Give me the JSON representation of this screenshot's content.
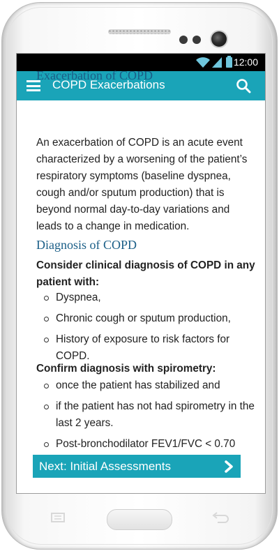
{
  "status_bar": {
    "time": "12:00"
  },
  "app_bar": {
    "title": "COPD Exacerbations"
  },
  "content": {
    "section1_title": "Exacerbation of COPD",
    "section1_text": "An exacerbation of COPD is an acute event characterized by a worsening of the patient’s respiratory symptoms (baseline dyspnea, cough and/or sputum production) that is beyond normal day-to-day variations and leads to a change in medication.",
    "section2_title": "Diagnosis of COPD",
    "lead1": "Consider clinical diagnosis of COPD in any patient with:",
    "list1": [
      "Dyspnea,",
      "Chronic cough or sputum production,",
      "History of exposure to risk factors for COPD."
    ],
    "lead2": "Confirm diagnosis with spirometry:",
    "list2": [
      "once the patient has stabilized and",
      "if the patient has not had spirometry in the last 2 years.",
      "Post-bronchodilator FEV1/FVC < 0.70"
    ]
  },
  "next_button": {
    "label": "Next: Initial Assessments"
  },
  "colors": {
    "accent": "#1aa4b8",
    "heading": "#1a5e87"
  },
  "icons": [
    "menu-icon",
    "search-icon",
    "chevron-right-icon",
    "wifi-icon",
    "signal-icon",
    "battery-icon"
  ]
}
